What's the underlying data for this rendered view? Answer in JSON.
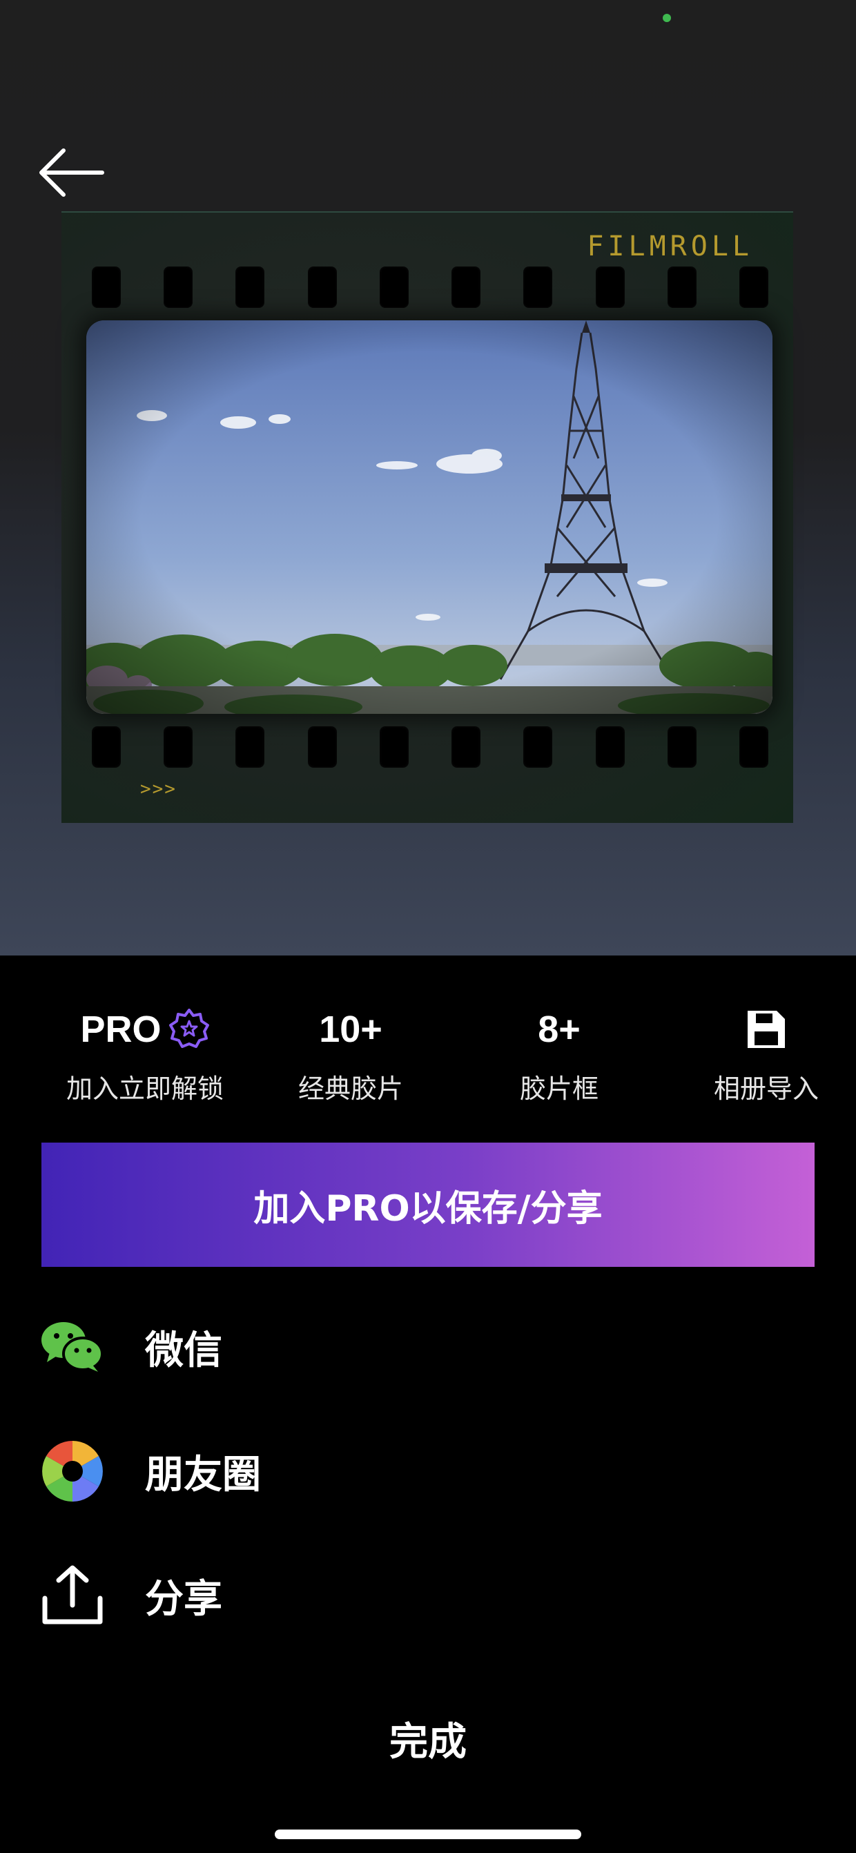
{
  "colors": {
    "accent_gradient_start": "#4224b6",
    "accent_gradient_end": "#c460d6",
    "pro_badge": "#8a5cf5",
    "film_label": "#b59a2e",
    "status_dot": "#3fb950"
  },
  "header": {
    "back_icon": "arrow-left-icon"
  },
  "film": {
    "brand": "FILMROLL",
    "arrows": ">>>"
  },
  "features": [
    {
      "title": "PRO",
      "caption": "加入立即解锁",
      "icon": "pro-badge-icon"
    },
    {
      "title": "10+",
      "caption": "经典胶片"
    },
    {
      "title": "8+",
      "caption": "胶片框"
    },
    {
      "title": "",
      "caption": "相册导入",
      "icon": "save-disk-icon"
    }
  ],
  "cta": {
    "label": "加入PRO以保存/分享"
  },
  "share": [
    {
      "label": "微信",
      "icon": "wechat-icon"
    },
    {
      "label": "朋友圈",
      "icon": "moments-icon"
    },
    {
      "label": "分享",
      "icon": "share-upload-icon"
    }
  ],
  "done_label": "完成"
}
